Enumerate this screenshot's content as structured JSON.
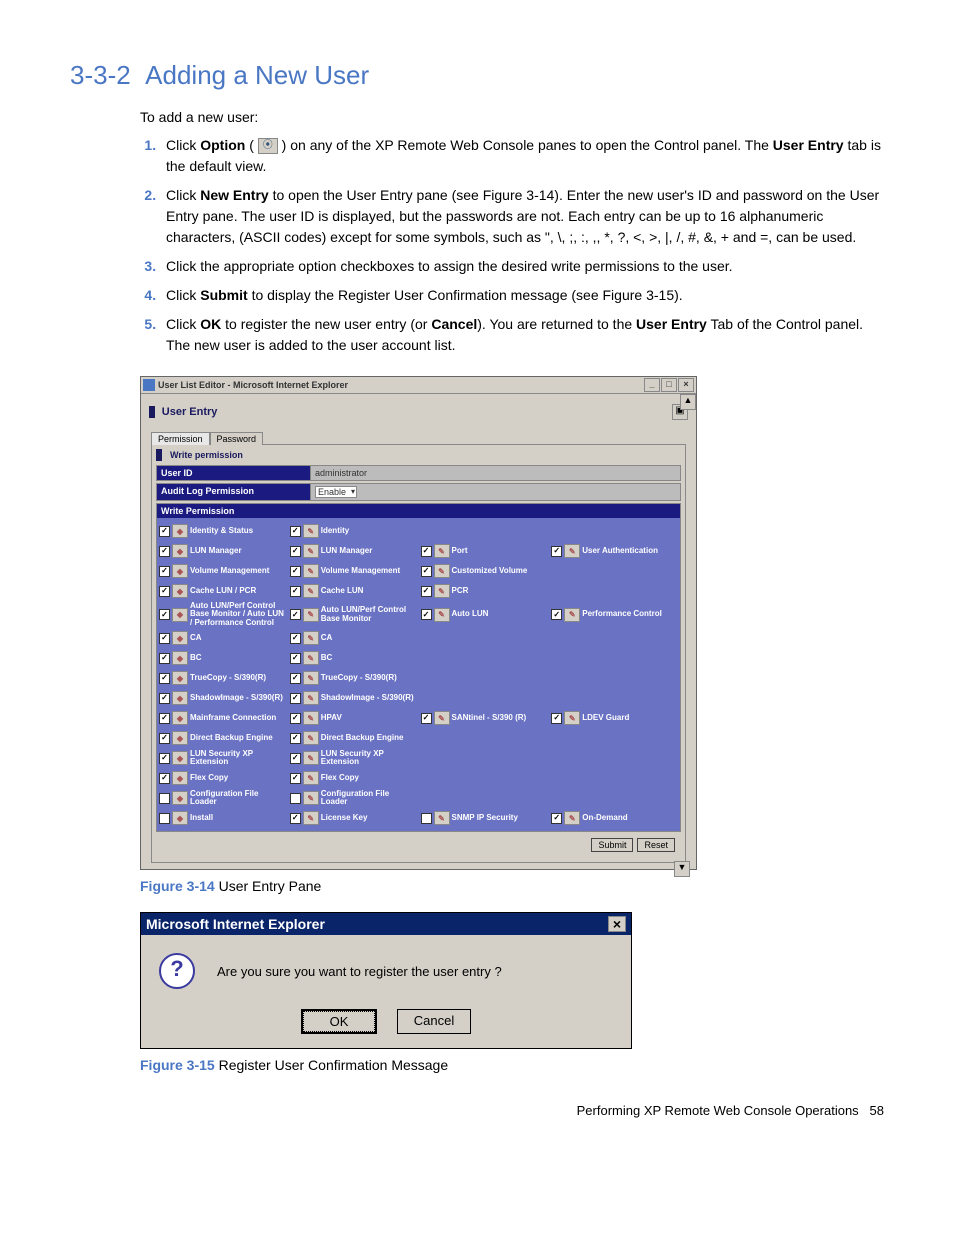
{
  "section": {
    "number": "3-3-2",
    "title": "Adding a New User",
    "intro": "To add a new user:"
  },
  "steps": {
    "1a": "Click ",
    "1b": "Option",
    "1c": " ( ",
    "1d": " ) on any of the XP Remote Web Console panes to open the Control panel. The ",
    "1e": "User Entry",
    "1f": " tab is the default view.",
    "2a": "Click ",
    "2b": "New Entry",
    "2c": " to open the User Entry pane (see Figure 3-14). Enter the new user's ID and password on the User Entry pane. The user ID is displayed, but the passwords are not. Each entry can be up to 16 alphanumeric characters, (ASCII codes) except for some symbols, such as \",  \\, ;, :, ,, *, ?, <, >, |, /, #, &, + and =, can be used.",
    "3": "Click the appropriate option checkboxes to assign the desired write permissions to the user.",
    "4a": "Click ",
    "4b": "Submit",
    "4c": " to display the Register User Confirmation message (see Figure 3-15).",
    "5a": "Click ",
    "5b": "OK",
    "5c": " to register the new user entry (or ",
    "5d": "Cancel",
    "5e": "). You are returned to the ",
    "5f": "User Entry",
    "5g": " Tab of the Control panel. The new user is added to the user account list."
  },
  "window": {
    "title": "User List Editor - Microsoft Internet Explorer",
    "pane_title": "User Entry",
    "tabs": {
      "permission": "Permission",
      "password": "Password"
    },
    "sub_label": "Write permission",
    "user_id_label": "User ID",
    "user_id_value": "administrator",
    "audit_label": "Audit Log Permission",
    "audit_value": "Enable",
    "write_perm_label": "Write Permission",
    "buttons": {
      "submit": "Submit",
      "reset": "Reset"
    }
  },
  "perm_cols": [
    "col1",
    "col2",
    "col3",
    "col4"
  ],
  "perm_rows": [
    [
      {
        "checked": true,
        "icon": "◆",
        "label": "Identity & Status"
      },
      {
        "checked": true,
        "icon": "✎",
        "label": "Identity"
      },
      null,
      null
    ],
    [
      {
        "checked": true,
        "icon": "◆",
        "label": "LUN Manager"
      },
      {
        "checked": true,
        "icon": "✎",
        "label": "LUN Manager"
      },
      {
        "checked": true,
        "icon": "✎",
        "label": "Port"
      },
      {
        "checked": true,
        "icon": "✎",
        "label": "User Authentication"
      }
    ],
    [
      {
        "checked": true,
        "icon": "◆",
        "label": "Volume Management"
      },
      {
        "checked": true,
        "icon": "✎",
        "label": "Volume Management"
      },
      {
        "checked": true,
        "icon": "✎",
        "label": "Customized Volume"
      },
      null
    ],
    [
      {
        "checked": true,
        "icon": "◆",
        "label": "Cache LUN / PCR"
      },
      {
        "checked": true,
        "icon": "✎",
        "label": "Cache LUN"
      },
      {
        "checked": true,
        "icon": "✎",
        "label": "PCR"
      },
      null
    ],
    [
      {
        "checked": true,
        "icon": "◆",
        "label": "Auto LUN/Perf Control Base Monitor / Auto LUN / Performance Control"
      },
      {
        "checked": true,
        "icon": "✎",
        "label": "Auto LUN/Perf Control Base Monitor"
      },
      {
        "checked": true,
        "icon": "✎",
        "label": "Auto LUN"
      },
      {
        "checked": true,
        "icon": "✎",
        "label": "Performance Control"
      }
    ],
    [
      {
        "checked": true,
        "icon": "◆",
        "label": "CA"
      },
      {
        "checked": true,
        "icon": "✎",
        "label": "CA"
      },
      null,
      null
    ],
    [
      {
        "checked": true,
        "icon": "◆",
        "label": "BC"
      },
      {
        "checked": true,
        "icon": "✎",
        "label": "BC"
      },
      null,
      null
    ],
    [
      {
        "checked": true,
        "icon": "◆",
        "label": "TrueCopy - S/390(R)"
      },
      {
        "checked": true,
        "icon": "✎",
        "label": "TrueCopy - S/390(R)"
      },
      null,
      null
    ],
    [
      {
        "checked": true,
        "icon": "◆",
        "label": "ShadowImage - S/390(R)"
      },
      {
        "checked": true,
        "icon": "✎",
        "label": "ShadowImage - S/390(R)"
      },
      null,
      null
    ],
    [
      {
        "checked": true,
        "icon": "◆",
        "label": "Mainframe Connection"
      },
      {
        "checked": true,
        "icon": "✎",
        "label": "HPAV"
      },
      {
        "checked": true,
        "icon": "✎",
        "label": "SANtinel - S/390 (R)"
      },
      {
        "checked": true,
        "icon": "✎",
        "label": "LDEV Guard"
      }
    ],
    [
      {
        "checked": true,
        "icon": "◆",
        "label": "Direct Backup Engine"
      },
      {
        "checked": true,
        "icon": "✎",
        "label": "Direct Backup Engine"
      },
      null,
      null
    ],
    [
      {
        "checked": true,
        "icon": "◆",
        "label": "LUN Security XP Extension"
      },
      {
        "checked": true,
        "icon": "✎",
        "label": "LUN Security XP Extension"
      },
      null,
      null
    ],
    [
      {
        "checked": true,
        "icon": "◆",
        "label": "Flex Copy"
      },
      {
        "checked": true,
        "icon": "✎",
        "label": "Flex Copy"
      },
      null,
      null
    ],
    [
      {
        "checked": false,
        "icon": "◆",
        "label": "Configuration File Loader"
      },
      {
        "checked": false,
        "icon": "✎",
        "label": "Configuration File Loader"
      },
      null,
      null
    ],
    [
      {
        "checked": false,
        "icon": "◆",
        "label": "Install"
      },
      {
        "checked": true,
        "icon": "✎",
        "label": "License Key"
      },
      {
        "checked": false,
        "icon": "✎",
        "label": "SNMP IP Security"
      },
      {
        "checked": true,
        "icon": "✎",
        "label": "On-Demand"
      }
    ]
  ],
  "figures": {
    "f14": {
      "num": "Figure 3-14",
      "text": " User Entry Pane"
    },
    "f15": {
      "num": "Figure 3-15",
      "text": " Register User Confirmation Message"
    }
  },
  "dialog": {
    "title": "Microsoft Internet Explorer",
    "message": "Are you sure you want to register the user entry ?",
    "ok": "OK",
    "cancel": "Cancel"
  },
  "footer": {
    "text": "Performing XP Remote Web Console Operations",
    "page": "58"
  }
}
